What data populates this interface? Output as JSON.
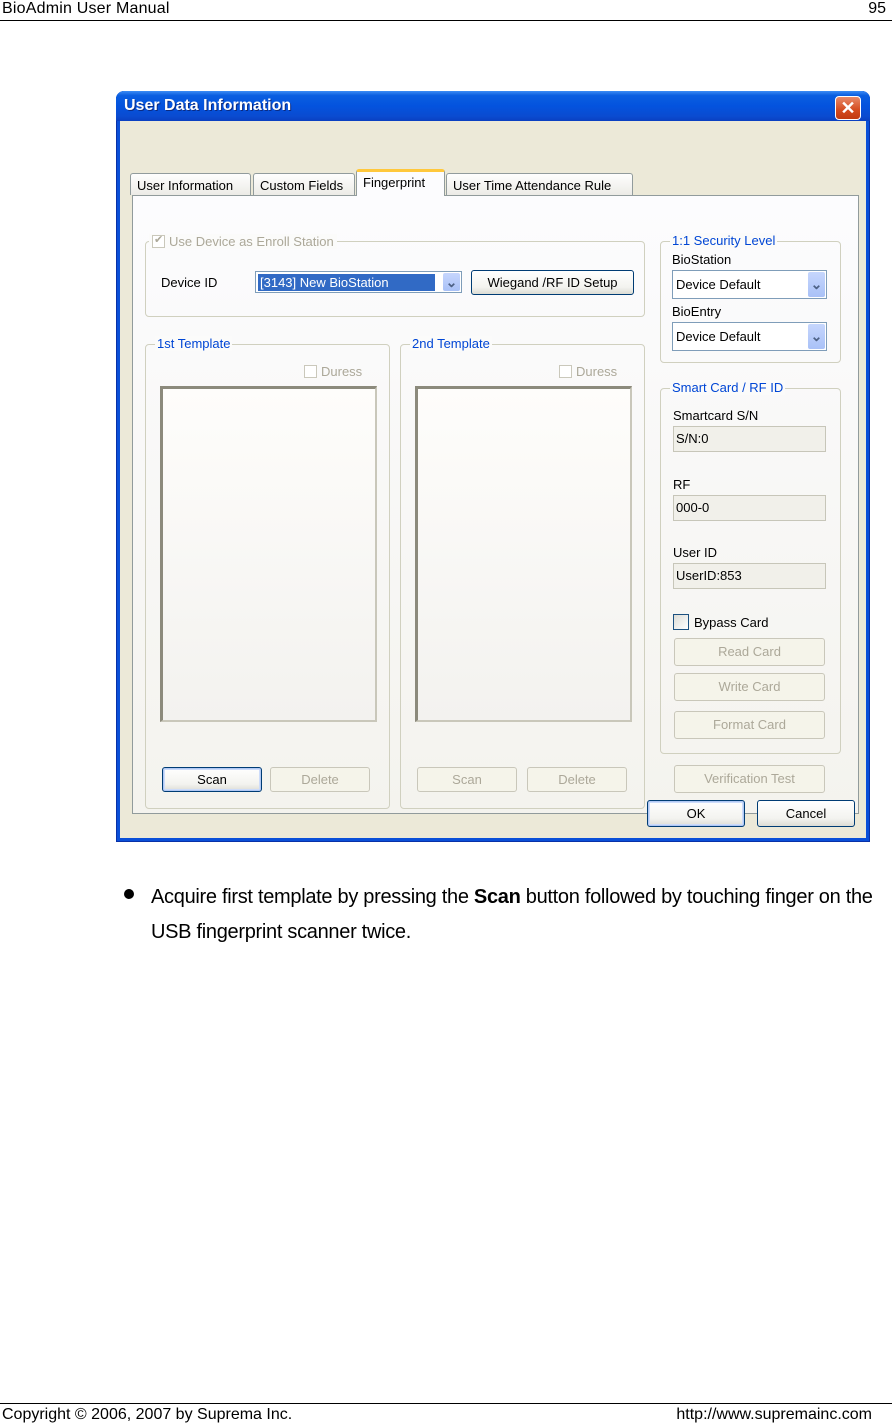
{
  "page": {
    "header_title": "BioAdmin  User  Manual",
    "page_number": "95",
    "footer_copyright": "Copyright © 2006, 2007 by Suprema Inc.",
    "footer_url": "http://www.supremainc.com"
  },
  "dialog": {
    "title": "User Data Information",
    "close_glyph": "✕",
    "tabs": [
      {
        "label": "User Information",
        "active": false
      },
      {
        "label": "Custom Fields",
        "active": false
      },
      {
        "label": "Fingerprint",
        "active": true
      },
      {
        "label": "User Time Attendance Rule",
        "active": false
      }
    ],
    "enroll": {
      "use_device_label": "Use Device as Enroll Station",
      "use_device_checked": true,
      "device_id_label": "Device ID",
      "device_id_value": "[3143] New BioStation",
      "wiegand_button": "Wiegand /RF ID Setup"
    },
    "template1": {
      "legend": "1st Template",
      "duress_label": "Duress",
      "scan_button": "Scan",
      "delete_button": "Delete"
    },
    "template2": {
      "legend": "2nd Template",
      "duress_label": "Duress",
      "scan_button": "Scan",
      "delete_button": "Delete"
    },
    "security": {
      "legend": "1:1 Security Level",
      "biostation_label": "BioStation",
      "biostation_value": "Device Default",
      "bioentry_label": "BioEntry",
      "bioentry_value": "Device Default"
    },
    "smartcard": {
      "legend": "Smart Card / RF ID",
      "sn_label": "Smartcard S/N",
      "sn_value": "S/N:0",
      "rf_label": "RF",
      "rf_value": "000-0",
      "userid_label": "User ID",
      "userid_value": "UserID:853",
      "bypass_label": "Bypass Card",
      "bypass_checked": false,
      "read_button": "Read Card",
      "write_button": "Write Card",
      "format_button": "Format Card"
    },
    "verification_button": "Verification Test",
    "ok_button": "OK",
    "cancel_button": "Cancel"
  },
  "body": {
    "bullet_pre": "Acquire first template by pressing the ",
    "bullet_bold": "Scan",
    "bullet_post": " button followed by touching finger on the USB fingerprint scanner twice."
  }
}
